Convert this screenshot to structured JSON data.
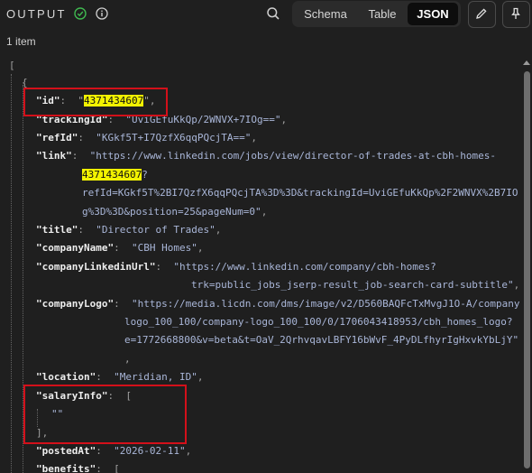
{
  "header": {
    "title": "OUTPUT",
    "status_icon": "check-circle-icon",
    "info_icon": "info-icon",
    "search_icon": "search-icon",
    "tabs": [
      {
        "label": "Schema",
        "active": false
      },
      {
        "label": "Table",
        "active": false
      },
      {
        "label": "JSON",
        "active": true
      }
    ],
    "edit_icon": "pencil-icon",
    "pin_icon": "pin-icon"
  },
  "item_count": "1 item",
  "json": {
    "open_bracket": "[",
    "open_brace": "{",
    "id_key": "\"id\"",
    "id_value": "4371434607",
    "trackingId_key": "\"trackingId\"",
    "trackingId_value": "\"UviGEfuKkQp/2WNVX+7IOg==\"",
    "refId_key": "\"refId\"",
    "refId_value": "\"KGkf5T+I7QzfX6qqPQcjTA==\"",
    "link_key": "\"link\"",
    "link_value_1": "\"https://www.linkedin.com/jobs/view/director-of-trades-at-cbh-homes-",
    "link_value_hl": "4371434607",
    "link_value_2": "?",
    "link_value_3": "refId=KGkf5T%2BI7QzfX6qqPQcjTA%3D%3D&trackingId=UviGEfuKkQp%2F2WNVX%2B7IO",
    "link_value_4": "g%3D%3D&position=25&pageNum=0\"",
    "title_key": "\"title\"",
    "title_value": "\"Director of Trades\"",
    "companyName_key": "\"companyName\"",
    "companyName_value": "\"CBH Homes\"",
    "companyLinkedinUrl_key": "\"companyLinkedinUrl\"",
    "companyLinkedinUrl_value_1": "\"https://www.linkedin.com/company/cbh-homes?",
    "companyLinkedinUrl_value_2": "trk=public_jobs_jserp-result_job-search-card-subtitle\"",
    "companyLogo_key": "\"companyLogo\"",
    "companyLogo_value_1": "\"https://media.licdn.com/dms/image/v2/D560BAQFcTxMvgJ1O-A/company-",
    "companyLogo_value_2": "logo_100_100/company-logo_100_100/0/1706043418953/cbh_homes_logo?",
    "companyLogo_value_3": "e=1772668800&v=beta&t=OaV_2QrhvqavLBFY16bWvF_4PyDLfhyrIgHxvkYbLjY\"",
    "companyLogo_value_4": ",",
    "location_key": "\"location\"",
    "location_value": "\"Meridian, ID\"",
    "salaryInfo_key": "\"salaryInfo\"",
    "salaryInfo_open": "[",
    "salaryInfo_item": "\"\"",
    "salaryInfo_close": "],",
    "postedAt_key": "\"postedAt\"",
    "postedAt_value": "\"2026-02-11\"",
    "benefits_key": "\"benefits\"",
    "benefits_open": "["
  },
  "colors": {
    "background": "#1f1f1f",
    "highlight": "#f2f200",
    "annotation_box": "#d3101a",
    "string": "#a9b6d8",
    "ok_green": "#3fb950"
  }
}
